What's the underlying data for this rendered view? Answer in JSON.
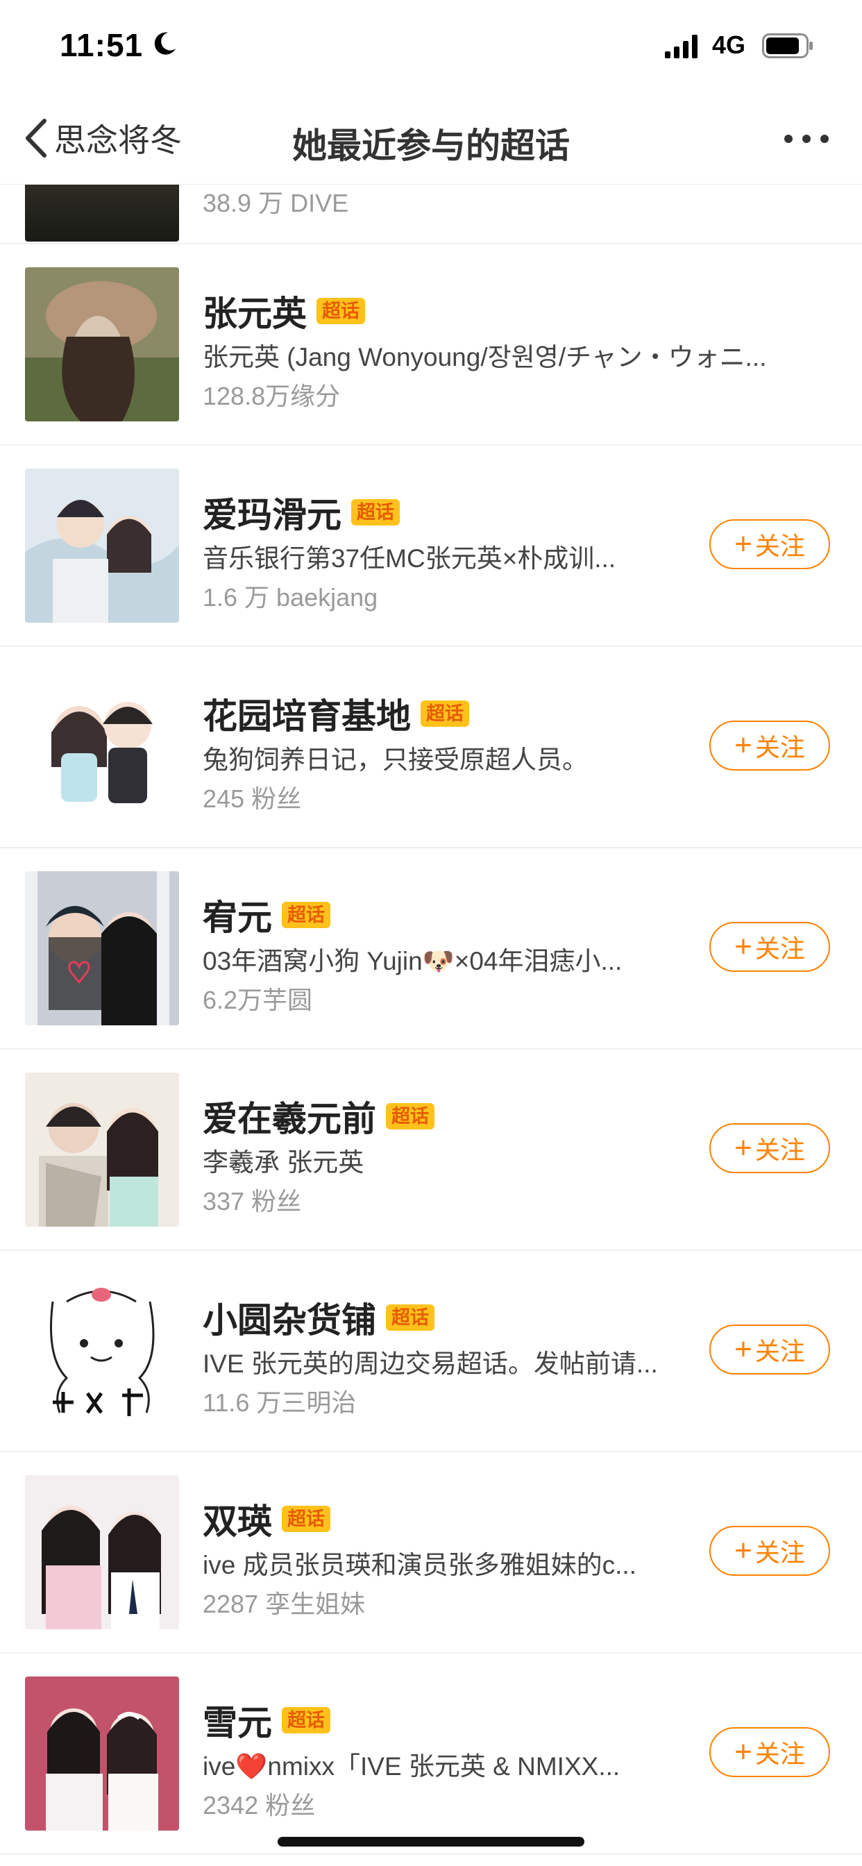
{
  "status_bar": {
    "time": "11:51",
    "network": "4G"
  },
  "nav": {
    "back_label": "思念将冬",
    "title": "她最近参与的超话"
  },
  "partial_item": {
    "meta": "38.9 万 DIVE"
  },
  "badge_label": "超话",
  "follow_label": "关注",
  "items": [
    {
      "name": "张元英",
      "desc": "张元英 (Jang Wonyoung/장원영/チャン・ウォニ...",
      "meta": "128.8万缘分",
      "followed": true
    },
    {
      "name": "爱玛滑元",
      "desc": "音乐银行第37任MC张元英×朴成训...",
      "meta": "1.6 万 baekjang",
      "followed": false
    },
    {
      "name": "花园培育基地",
      "desc": "兔狗饲养日记，只接受原超人员。",
      "meta": "245 粉丝",
      "followed": false
    },
    {
      "name": "宥元",
      "desc": "03年酒窝小狗 Yujin🐶×04年泪痣小...",
      "meta": "6.2万芋圆",
      "followed": false
    },
    {
      "name": "爱在羲元前",
      "desc": "李羲承  张元英",
      "meta": "337 粉丝",
      "followed": false
    },
    {
      "name": "小圆杂货铺",
      "desc": "IVE 张元英的周边交易超话。发帖前请...",
      "meta": "11.6 万三明治",
      "followed": false
    },
    {
      "name": "双瑛",
      "desc": "ive 成员张员瑛和演员张多雅姐妹的c...",
      "meta": "2287 孪生姐妹",
      "followed": false
    },
    {
      "name": "雪元",
      "desc": "ive❤️nmixx「IVE 张元英 & NMIXX...",
      "meta": "2342 粉丝",
      "followed": false
    }
  ]
}
